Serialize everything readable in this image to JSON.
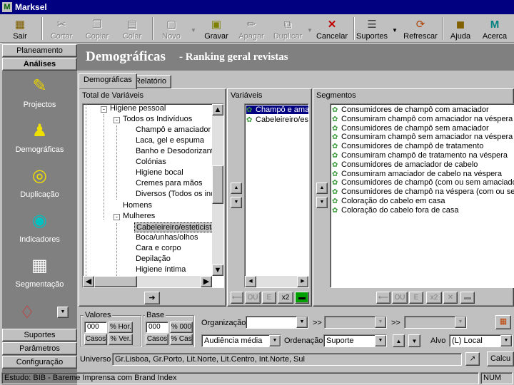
{
  "window": {
    "title": "Marksel"
  },
  "toolbar": {
    "sair": "Sair",
    "cortar": "Cortar",
    "copiar": "Copiar",
    "colar": "Colar",
    "novo": "Novo",
    "gravar": "Gravar",
    "apagar": "Apagar",
    "duplicar": "Duplicar",
    "cancelar": "Cancelar",
    "suportes": "Suportes",
    "refrescar": "Refrescar",
    "ajuda": "Ajuda",
    "acerca": "Acerca"
  },
  "sidebar": {
    "top_buttons": [
      "Planeamento",
      "Análises"
    ],
    "items": [
      {
        "label": "Projectos",
        "icon": "folder-check-icon"
      },
      {
        "label": "Demográficas",
        "icon": "demographics-icon"
      },
      {
        "label": "Duplicação",
        "icon": "duplication-icon"
      },
      {
        "label": "Indicadores",
        "icon": "indicators-icon"
      },
      {
        "label": "Segmentação",
        "icon": "network-icon"
      }
    ],
    "bottom_buttons": [
      "Suportes",
      "Parâmetros",
      "Configuração"
    ]
  },
  "header": {
    "title": "Demográficas",
    "subtitle": "- Ranking geral revistas"
  },
  "tabs": [
    {
      "label": "Demográficas",
      "active": true
    },
    {
      "label": "Relatório",
      "active": false
    }
  ],
  "variables_panel": {
    "title": "Total de Variáveis",
    "tree": [
      {
        "label": "Higiene pessoal",
        "level": 0,
        "toggle": "-"
      },
      {
        "label": "Todos os Indivíduos",
        "level": 1,
        "toggle": "-"
      },
      {
        "label": "Champô e amaciador",
        "level": 2
      },
      {
        "label": "Laca, gel e espuma",
        "level": 2
      },
      {
        "label": "Banho e Desodorizante",
        "level": 2
      },
      {
        "label": "Colónias",
        "level": 2
      },
      {
        "label": "Higiene bocal",
        "level": 2
      },
      {
        "label": "Cremes para mãos",
        "level": 2
      },
      {
        "label": "Diversos (Todos os indi",
        "level": 2
      },
      {
        "label": "Homens",
        "level": 1,
        "toggle": "+"
      },
      {
        "label": "Mulheres",
        "level": 1,
        "toggle": "-"
      },
      {
        "label": "Cabeleireiro/esteticista",
        "level": 2,
        "selected": true
      },
      {
        "label": "Boca/unhas/olhos",
        "level": 2
      },
      {
        "label": "Cara e corpo",
        "level": 2
      },
      {
        "label": "Depilação",
        "level": 2
      },
      {
        "label": "Higiene íntima",
        "level": 2
      }
    ]
  },
  "selected_variables": {
    "title": "Variáveis",
    "items": [
      {
        "label": "Champô e amac",
        "selected": true
      },
      {
        "label": "Cabeleireiro/est",
        "selected": false
      }
    ],
    "buttons": [
      "OU",
      "E",
      "x2"
    ]
  },
  "segments": {
    "title": "Segmentos",
    "items": [
      "Consumidores de champô com amaciador",
      "Consumiram champô com amaciador na véspera",
      "Consumidores de champô sem amaciador",
      "Consumiram champô sem amaciador na véspera",
      "Consumidores de champô de tratamento",
      "Consumiram champô de tratamento na véspera",
      "Consumidores de amaciador de cabelo",
      "Consumiram amaciador de cabelo na véspera",
      "Consumidores de champô (com ou sem amaciador)",
      "Consumidores de champô na véspera (com ou sem am",
      "Coloração do cabelo em casa",
      "Coloração do cabelo fora de casa"
    ],
    "buttons": [
      "OU",
      "E",
      "x2"
    ]
  },
  "valores": {
    "label": "Valores",
    "field": "000",
    "pct_hor": "% Hor.",
    "casos": "Casos",
    "pct_ver": "% Ver."
  },
  "base": {
    "label": "Base",
    "field": "000",
    "pct_000": "% 000",
    "casos": "Casos",
    "pct_cas": "% Cas"
  },
  "organizacao": {
    "label": "Organização",
    "value": "",
    "arrows1": ">>",
    "arrows2": ">>"
  },
  "audiencia": {
    "value": "Audiência média"
  },
  "ordenacao": {
    "label": "Ordenação",
    "value": "Suporte"
  },
  "alvo": {
    "label": "Alvo",
    "value": "(L) Local"
  },
  "universo": {
    "label": "Universo",
    "value": "Gr.Lisboa, Gr.Porto, Lit.Norte, Lit.Centro, Int.Norte, Sul"
  },
  "calcular": "Calcu",
  "status": {
    "study": "Estudo: BIB - Bareme Imprensa com Brand Index",
    "num": "NUM"
  }
}
